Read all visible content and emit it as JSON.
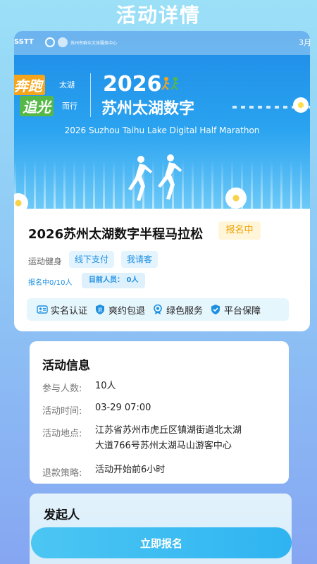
{
  "page": {
    "title": "活动详情"
  },
  "banner": {
    "logo_text": "SSTT",
    "org_text": "苏州市群众文体服务中心",
    "date_text": "3月",
    "slogan_line1": "奔跑",
    "slogan_line1_small": "太湖",
    "slogan_line2": "追光",
    "slogan_line2_small": "而行",
    "year": "2026",
    "event_name": "苏州太湖数字",
    "english_name": "2026 Suzhou Taihu Lake Digital Half Marathon"
  },
  "event": {
    "title": "2026苏州太湖数字半程马拉松",
    "status": "报名中",
    "category": "运动健身",
    "tags": [
      "线下支付",
      "我请客"
    ],
    "enroll_count": "报名中0/10人",
    "current_members": "目前人员： 0人"
  },
  "features": [
    {
      "label": "实名认证",
      "icon": "id-card-icon"
    },
    {
      "label": "爽约包退",
      "icon": "refund-shield-icon"
    },
    {
      "label": "绿色服务",
      "icon": "service-badge-icon"
    },
    {
      "label": "平台保障",
      "icon": "guarantee-shield-icon"
    }
  ],
  "info": {
    "title": "活动信息",
    "participants_label": "参与人数:",
    "participants_value": "10人",
    "time_label": "活动时间:",
    "time_value": "03-29 07:00",
    "location_label": "活动地点:",
    "location_value_line1": "江苏省苏州市虎丘区镇湖街道北太湖",
    "location_value_line2": "大道766号苏州太湖马山游客中心",
    "refund_label": "退款策略:",
    "refund_value": "活动开始前6小时"
  },
  "sponsor": {
    "title": "发起人"
  },
  "cta": {
    "signup_label": "立即报名"
  },
  "colors": {
    "accent": "#1d8fe1",
    "status": "#f0a000",
    "button": "#3dbbf2"
  }
}
